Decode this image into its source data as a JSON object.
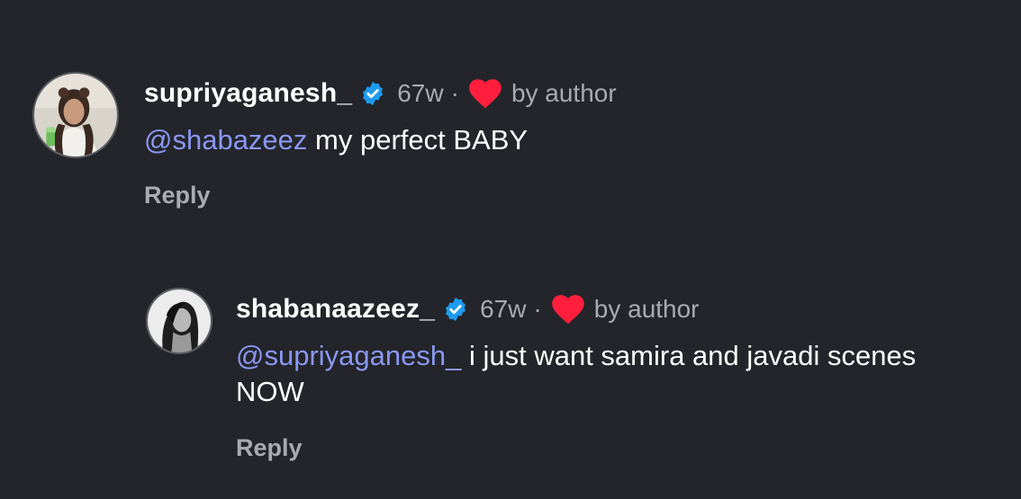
{
  "comments": [
    {
      "username": "supriyaganesh_",
      "time": "67w",
      "separator": "·",
      "liked_label": "by author",
      "mention": "@shabazeez",
      "text": " my perfect BABY",
      "reply_label": "Reply",
      "avatar": "profile-photo"
    },
    {
      "username": "shabanaazeez_",
      "time": "67w",
      "separator": "·",
      "liked_label": "by author",
      "mention": "@supriyaganesh_",
      "text": " i just want samira and javadi scenes NOW",
      "reply_label": "Reply",
      "avatar": "profile-photo"
    }
  ],
  "colors": {
    "background": "#23252a",
    "mention": "#8b97f3",
    "verified": "#1d9bf0",
    "heart": "#ff1f3d",
    "muted": "#a8abb0"
  },
  "icons": {
    "verified": "verified-badge-icon",
    "heart": "heart-icon"
  }
}
